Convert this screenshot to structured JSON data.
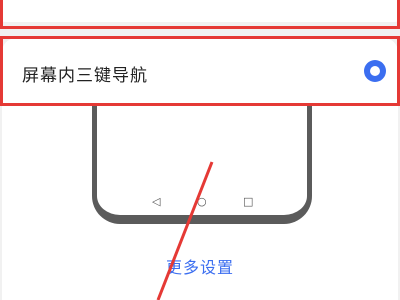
{
  "option": {
    "label": "屏幕内三键导航",
    "selected": true
  },
  "preview": {
    "nav_icons": [
      "back-triangle-icon",
      "home-circle-icon",
      "recents-square-icon"
    ]
  },
  "more_settings": {
    "label": "更多设置"
  },
  "colors": {
    "accent": "#3b6ef0",
    "highlight_red": "#e53935",
    "phone_frame": "#5b5b5b"
  }
}
